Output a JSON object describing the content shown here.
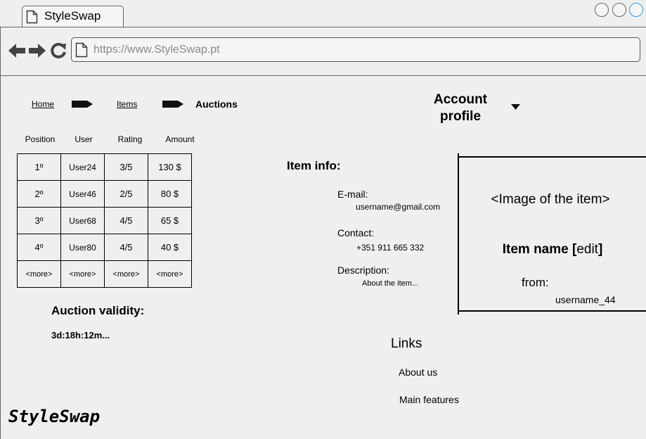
{
  "browser": {
    "tab_title": "StyleSwap",
    "url": "https://www.StyleSwap.pt"
  },
  "breadcrumb": {
    "home": "Home",
    "items": "Items",
    "current": "Auctions"
  },
  "account": {
    "label_line1": "Account",
    "label_line2": "profile"
  },
  "auction_table": {
    "headers": [
      "Position",
      "User",
      "Rating",
      "Amount"
    ],
    "rows": [
      [
        "1º",
        "User24",
        "3/5",
        "130 $"
      ],
      [
        "2º",
        "User46",
        "2/5",
        "80 $"
      ],
      [
        "3º",
        "User68",
        "4/5",
        "65 $"
      ],
      [
        "4º",
        "User80",
        "4/5",
        "40 $"
      ],
      [
        "<more>",
        "<more>",
        "<more>",
        "<more>"
      ]
    ]
  },
  "validity": {
    "title": "Auction validity:",
    "value": "3d:18h:12m..."
  },
  "item_info": {
    "title": "Item info:",
    "email_label": "E-mail:",
    "email_value": "username@gmail.com",
    "contact_label": "Contact:",
    "contact_value": "+351 911 665 332",
    "description_label": "Description:",
    "description_value": "About the item..."
  },
  "item_card": {
    "image_placeholder": "<Image of the item>",
    "name_bold": "Item name [",
    "edit_link": "edit",
    "name_close": "]",
    "from_label": "from:",
    "seller": "username_44"
  },
  "links": {
    "title": "Links",
    "items": [
      "About us",
      "Main features"
    ]
  },
  "footer": {
    "brand": "StyleSwap"
  }
}
